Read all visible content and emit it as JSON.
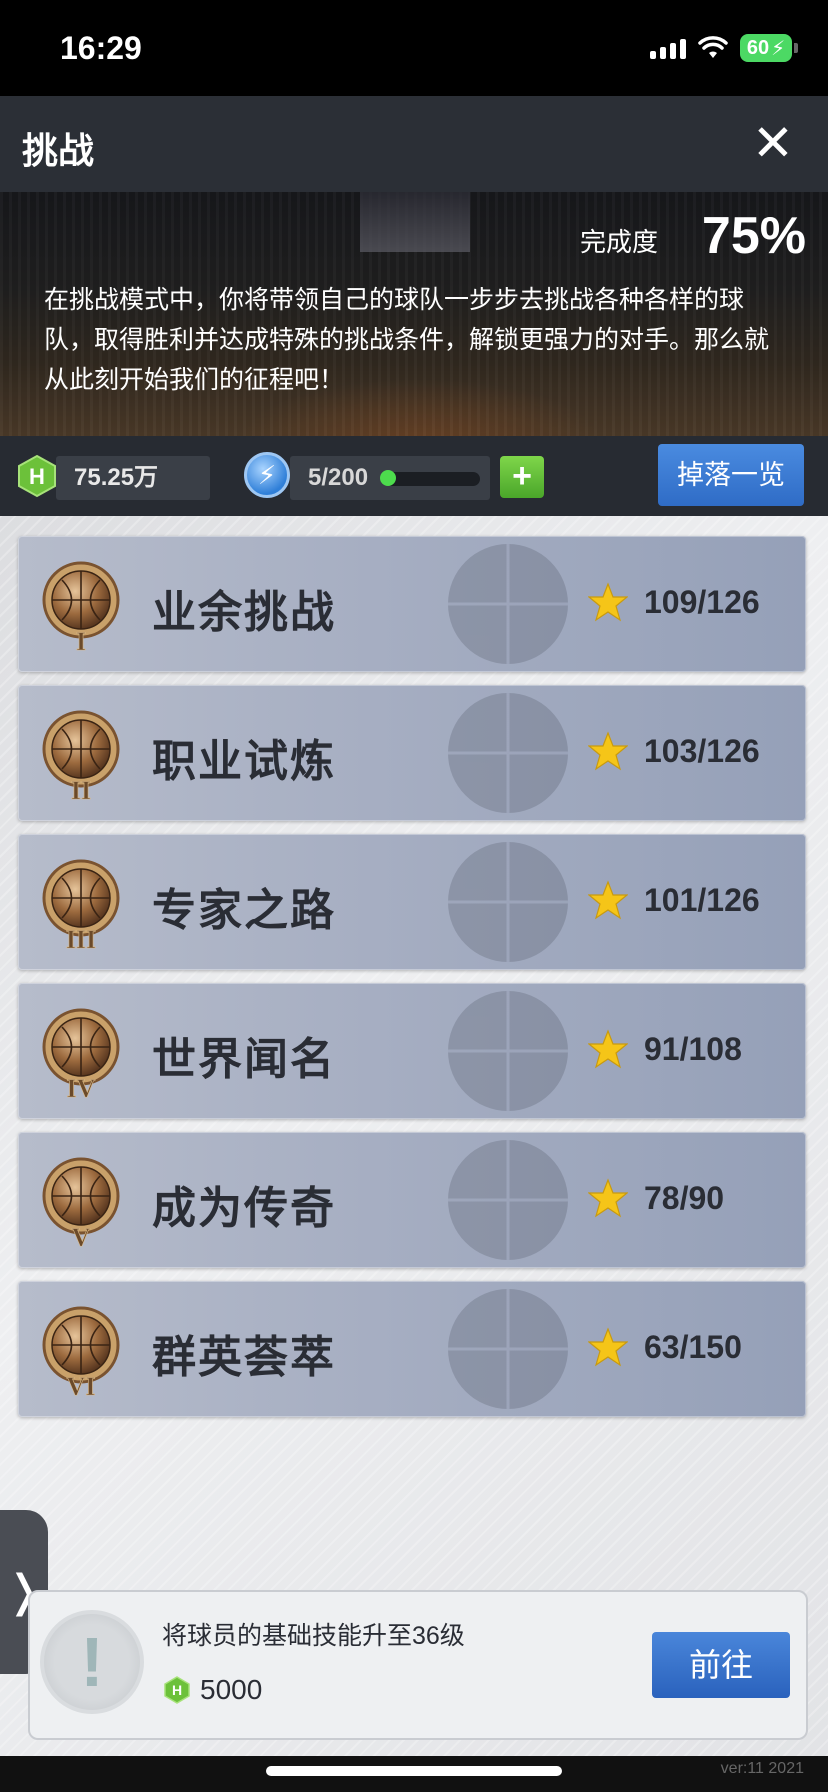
{
  "status_bar": {
    "time": "16:29",
    "battery": "60"
  },
  "header": {
    "title": "挑战",
    "close_label": "✕"
  },
  "banner": {
    "complete_label": "完成度",
    "complete_value": "75%",
    "description": "在挑战模式中，你将带领自己的球队一步步去挑战各种各样的球队，取得胜利并达成特殊的挑战条件，解锁更强力的对手。那么就从此刻开始我们的征程吧！"
  },
  "resources": {
    "coins": "75.25万",
    "energy": "5/200",
    "energy_fraction": 0.025,
    "plus_label": "+",
    "drop_list_label": "掉落一览"
  },
  "challenges": [
    {
      "numeral": "I",
      "name": "业余挑战",
      "stars": "109/126"
    },
    {
      "numeral": "II",
      "name": "职业试炼",
      "stars": "103/126"
    },
    {
      "numeral": "III",
      "name": "专家之路",
      "stars": "101/126"
    },
    {
      "numeral": "IV",
      "name": "世界闻名",
      "stars": "91/108"
    },
    {
      "numeral": "V",
      "name": "成为传奇",
      "stars": "78/90"
    },
    {
      "numeral": "VI",
      "name": "群英荟萃",
      "stars": "63/150"
    }
  ],
  "side_tab": {
    "label": "❭"
  },
  "task": {
    "icon_glyph": "!",
    "text": "将球员的基础技能升至36级",
    "reward": "5000",
    "go_label": "前往"
  },
  "version": "ver:11  2021",
  "colors": {
    "header_bg": "#2b2f36",
    "button_blue": "#3a78d4",
    "plus_green": "#5bbf35",
    "star_gold": "#f5c518"
  }
}
